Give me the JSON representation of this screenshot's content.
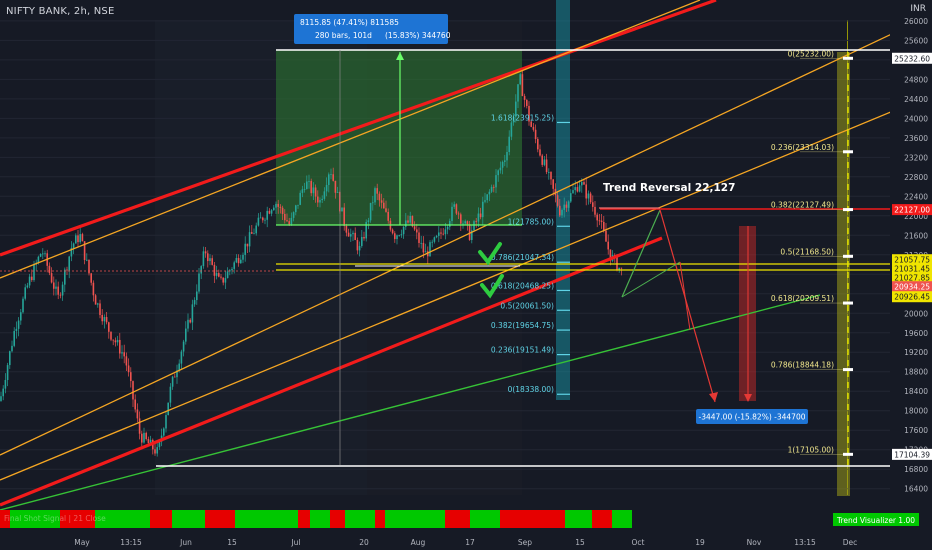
{
  "header": {
    "symbol": "NIFTY BANK, 2h, NSE",
    "currency": "INR"
  },
  "colors": {
    "up": "#26a69a",
    "down": "#ef5350",
    "bg": "#161a25",
    "grid": "#222633",
    "channel_red": "#f21b1b",
    "channel_orange": "#f5a623",
    "support_green": "#36c236",
    "level_yellow": "#f0e500",
    "fib_cyan": "#5fd3e6",
    "fib_yellow": "#f0e68c"
  },
  "chart_data": {
    "type": "candlestick",
    "title": "NIFTY BANK, 2h, NSE",
    "x_ticks": [
      "May",
      "13:15",
      "Jun",
      "15",
      "Jul",
      "20",
      "Aug",
      "17",
      "Sep",
      "15",
      "Oct",
      "19",
      "Nov",
      "13:15",
      "Dec"
    ],
    "y_ticks": [
      16400,
      16800,
      17200,
      17600,
      18000,
      18400,
      18800,
      19200,
      19600,
      20000,
      20400,
      20800,
      21200,
      21600,
      22000,
      22400,
      22800,
      23200,
      23600,
      24000,
      24400,
      24800,
      25200,
      25600,
      26000
    ],
    "ylim": [
      16250,
      26100
    ],
    "price_path": [
      [
        0,
        18200
      ],
      [
        15,
        19700
      ],
      [
        28,
        20600
      ],
      [
        42,
        21300
      ],
      [
        58,
        20300
      ],
      [
        72,
        21400
      ],
      [
        80,
        21600
      ],
      [
        95,
        20300
      ],
      [
        110,
        19600
      ],
      [
        125,
        19100
      ],
      [
        140,
        17500
      ],
      [
        158,
        17130
      ],
      [
        170,
        18400
      ],
      [
        190,
        19900
      ],
      [
        205,
        21300
      ],
      [
        220,
        20600
      ],
      [
        240,
        21200
      ],
      [
        260,
        21900
      ],
      [
        275,
        22300
      ],
      [
        290,
        21800
      ],
      [
        305,
        22700
      ],
      [
        320,
        22300
      ],
      [
        330,
        23000
      ],
      [
        345,
        21800
      ],
      [
        360,
        21300
      ],
      [
        375,
        22500
      ],
      [
        395,
        21600
      ],
      [
        410,
        21900
      ],
      [
        425,
        21200
      ],
      [
        440,
        21600
      ],
      [
        455,
        22200
      ],
      [
        470,
        21600
      ],
      [
        490,
        22500
      ],
      [
        505,
        23200
      ],
      [
        520,
        24800
      ],
      [
        530,
        23900
      ],
      [
        545,
        23000
      ],
      [
        560,
        22100
      ],
      [
        580,
        22700
      ],
      [
        598,
        22000
      ],
      [
        610,
        21200
      ],
      [
        622,
        20850
      ]
    ],
    "horizontal_levels": [
      {
        "price": 25232.6,
        "label": "25232.60",
        "color": "#ffffff"
      },
      {
        "price": 17104.39,
        "label": "17104.39",
        "color": "#ffffff"
      },
      {
        "price": 22127.0,
        "label": "22127.00",
        "color": "#f21b1b"
      },
      {
        "price": 21057.75,
        "label": "21057.75",
        "color": "#f0e500"
      },
      {
        "price": 21031.45,
        "label": "21031.45",
        "color": "#f0e500"
      },
      {
        "price": 21027.85,
        "label": "21027.85",
        "color": "#f0e500"
      },
      {
        "price": 20934.25,
        "label": "20934.25",
        "color": "#ef5350"
      },
      {
        "price": 20926.45,
        "label": "20926.45",
        "color": "#f0e500"
      }
    ],
    "fib_right": [
      {
        "ratio": "0",
        "price": 25232.0,
        "label": "0(25232.00)"
      },
      {
        "ratio": "0.236",
        "price": 23314.03,
        "label": "0.236(23314.03)"
      },
      {
        "ratio": "0.382",
        "price": 22127.49,
        "label": "0.382(22127.49)"
      },
      {
        "ratio": "0.5",
        "price": 21168.5,
        "label": "0.5(21168.50)"
      },
      {
        "ratio": "0.618",
        "price": 20209.51,
        "label": "0.618(20209.51)"
      },
      {
        "ratio": "0.786",
        "price": 18844.18,
        "label": "0.786(18844.18)"
      },
      {
        "ratio": "1",
        "price": 17105.0,
        "label": "1(17105.00)"
      }
    ],
    "fib_mid": [
      {
        "ratio": "1.618",
        "price": 23915.25,
        "label": "1.618(23915.25)"
      },
      {
        "ratio": "1",
        "price": 21785.0,
        "label": "1(21785.00)"
      },
      {
        "ratio": "0.786",
        "price": 21047.34,
        "label": "0.786(21047.34)"
      },
      {
        "ratio": "0.618",
        "price": 20468.25,
        "label": "0.618(20468.25)"
      },
      {
        "ratio": "0.5",
        "price": 20061.5,
        "label": "0.5(20061.50)"
      },
      {
        "ratio": "0.382",
        "price": 19654.75,
        "label": "0.382(19654.75)"
      },
      {
        "ratio": "0.236",
        "price": 19151.49,
        "label": "0.236(19151.49)"
      },
      {
        "ratio": "0",
        "price": 18338.0,
        "label": "0(18338.00)"
      }
    ],
    "annotations": {
      "measure_top_line1": "8115.85 (47.41%) 811585",
      "measure_top_line2": "280 bars, 101d",
      "measure_top_line3": "(15.83%) 344760",
      "measure_bottom": "-3447.00 (-15.82%) -344700",
      "trend_reversal": "Trend Reversal 22,127",
      "indicator_name": "Trend Visualizer",
      "indicator_value": "1.00",
      "indicator_overlay": "Final Shot Signal | 21 Close"
    },
    "grid": true,
    "legend": "none"
  }
}
